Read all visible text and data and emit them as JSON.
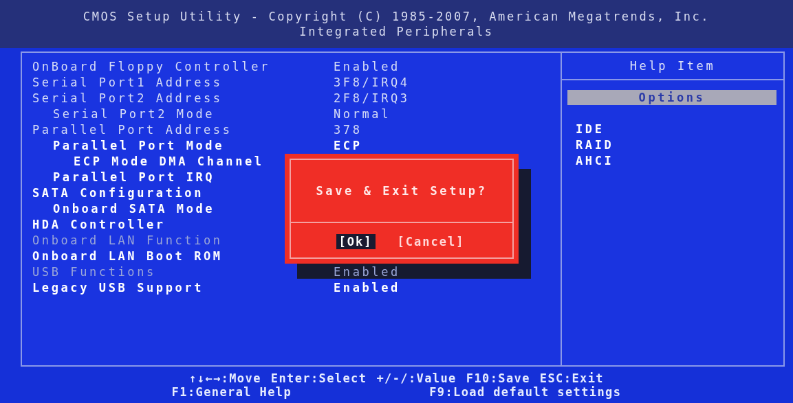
{
  "header": {
    "title": "CMOS Setup Utility - Copyright (C) 1985-2007, American Megatrends, Inc.",
    "subtitle": "Integrated Peripherals"
  },
  "settings": [
    {
      "label": "OnBoard Floppy Controller",
      "kind": "normal",
      "value": "Enabled"
    },
    {
      "label": "Serial Port1 Address",
      "kind": "normal",
      "value": "3F8/IRQ4"
    },
    {
      "label": "Serial Port2 Address",
      "kind": "normal",
      "value": "2F8/IRQ3",
      "children": [
        {
          "label": "Serial Port2 Mode",
          "kind": "normal",
          "value": "Normal"
        }
      ]
    },
    {
      "label": "Parallel Port Address",
      "kind": "normal",
      "value": "378",
      "children": [
        {
          "label": "Parallel Port Mode",
          "kind": "highlighted",
          "value": "ECP",
          "children": [
            {
              "label": "ECP Mode DMA Channel",
              "kind": "highlighted"
            }
          ]
        },
        {
          "label": "Parallel Port IRQ",
          "kind": "highlighted"
        }
      ]
    },
    {
      "label": "SATA Configuration",
      "kind": "highlighted",
      "children": [
        {
          "label": "Onboard SATA Mode",
          "kind": "highlighted"
        }
      ]
    },
    {
      "label": "HDA Controller",
      "kind": "highlighted"
    },
    {
      "label": "Onboard LAN Function",
      "kind": "disabled"
    },
    {
      "label": "Onboard LAN Boot ROM",
      "kind": "highlighted"
    },
    {
      "label": "USB Functions",
      "kind": "disabled",
      "value": "Enabled"
    },
    {
      "label": "Legacy USB Support",
      "kind": "highlighted",
      "value": "Enabled"
    }
  ],
  "help": {
    "title": "Help Item",
    "options_heading": "Options",
    "options": [
      "IDE",
      "RAID",
      "AHCI"
    ]
  },
  "dialog": {
    "message": "Save & Exit Setup?",
    "buttons": [
      {
        "label": "[Ok]",
        "selected": true
      },
      {
        "label": "[Cancel]",
        "selected": false
      }
    ]
  },
  "footer": {
    "lines": [
      [
        "↑↓←→:Move",
        "Enter:Select",
        "+/-/:Value",
        "F10:Save",
        "ESC:Exit"
      ],
      [
        "F1:General Help",
        "F9:Load default settings"
      ]
    ]
  }
}
